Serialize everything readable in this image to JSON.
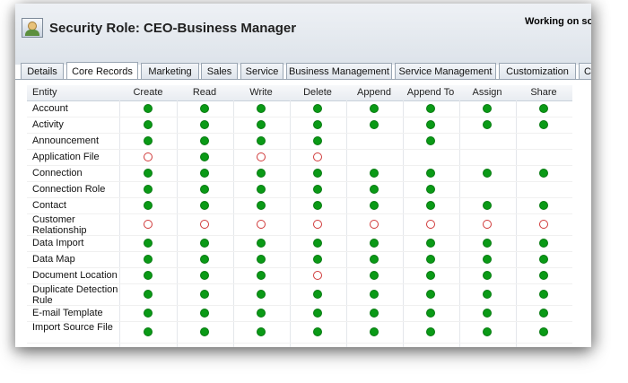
{
  "header": {
    "title": "Security Role: CEO-Business Manager",
    "working_on": "Working on sol"
  },
  "tabs": [
    {
      "label": "Details",
      "active": false
    },
    {
      "label": "Core Records",
      "active": true
    },
    {
      "label": "Marketing",
      "active": false
    },
    {
      "label": "Sales",
      "active": false
    },
    {
      "label": "Service",
      "active": false
    },
    {
      "label": "Business Management",
      "active": false
    },
    {
      "label": "Service Management",
      "active": false
    },
    {
      "label": "Customization",
      "active": false
    },
    {
      "label": "C",
      "active": false
    }
  ],
  "grid": {
    "entity_header": "Entity",
    "columns": [
      "Create",
      "Read",
      "Write",
      "Delete",
      "Append",
      "Append To",
      "Assign",
      "Share"
    ],
    "legend_values": {
      "F": "full access (green filled circle)",
      "N": "no access (red outlined circle)",
      "": "not applicable"
    },
    "rows": [
      {
        "entity": "Account",
        "access": [
          "F",
          "F",
          "F",
          "F",
          "F",
          "F",
          "F",
          "F"
        ]
      },
      {
        "entity": "Activity",
        "access": [
          "F",
          "F",
          "F",
          "F",
          "F",
          "F",
          "F",
          "F"
        ]
      },
      {
        "entity": "Announcement",
        "access": [
          "F",
          "F",
          "F",
          "F",
          "",
          "F",
          "",
          ""
        ]
      },
      {
        "entity": "Application File",
        "access": [
          "N",
          "F",
          "N",
          "N",
          "",
          "",
          "",
          ""
        ]
      },
      {
        "entity": "Connection",
        "access": [
          "F",
          "F",
          "F",
          "F",
          "F",
          "F",
          "F",
          "F"
        ]
      },
      {
        "entity": "Connection Role",
        "access": [
          "F",
          "F",
          "F",
          "F",
          "F",
          "F",
          "",
          ""
        ]
      },
      {
        "entity": "Contact",
        "access": [
          "F",
          "F",
          "F",
          "F",
          "F",
          "F",
          "F",
          "F"
        ]
      },
      {
        "entity": "Customer Relationship",
        "access": [
          "N",
          "N",
          "N",
          "N",
          "N",
          "N",
          "N",
          "N"
        ]
      },
      {
        "entity": "Data Import",
        "access": [
          "F",
          "F",
          "F",
          "F",
          "F",
          "F",
          "F",
          "F"
        ]
      },
      {
        "entity": "Data Map",
        "access": [
          "F",
          "F",
          "F",
          "F",
          "F",
          "F",
          "F",
          "F"
        ]
      },
      {
        "entity": "Document Location",
        "access": [
          "F",
          "F",
          "F",
          "N",
          "F",
          "F",
          "F",
          "F"
        ]
      },
      {
        "entity": "Duplicate Detection Rule",
        "access": [
          "F",
          "F",
          "F",
          "F",
          "F",
          "F",
          "F",
          "F"
        ]
      },
      {
        "entity": "E-mail Template",
        "access": [
          "F",
          "F",
          "F",
          "F",
          "F",
          "F",
          "F",
          "F"
        ]
      },
      {
        "entity": "Import Source File",
        "access": [
          "F",
          "F",
          "F",
          "F",
          "F",
          "F",
          "F",
          "F"
        ]
      }
    ]
  }
}
